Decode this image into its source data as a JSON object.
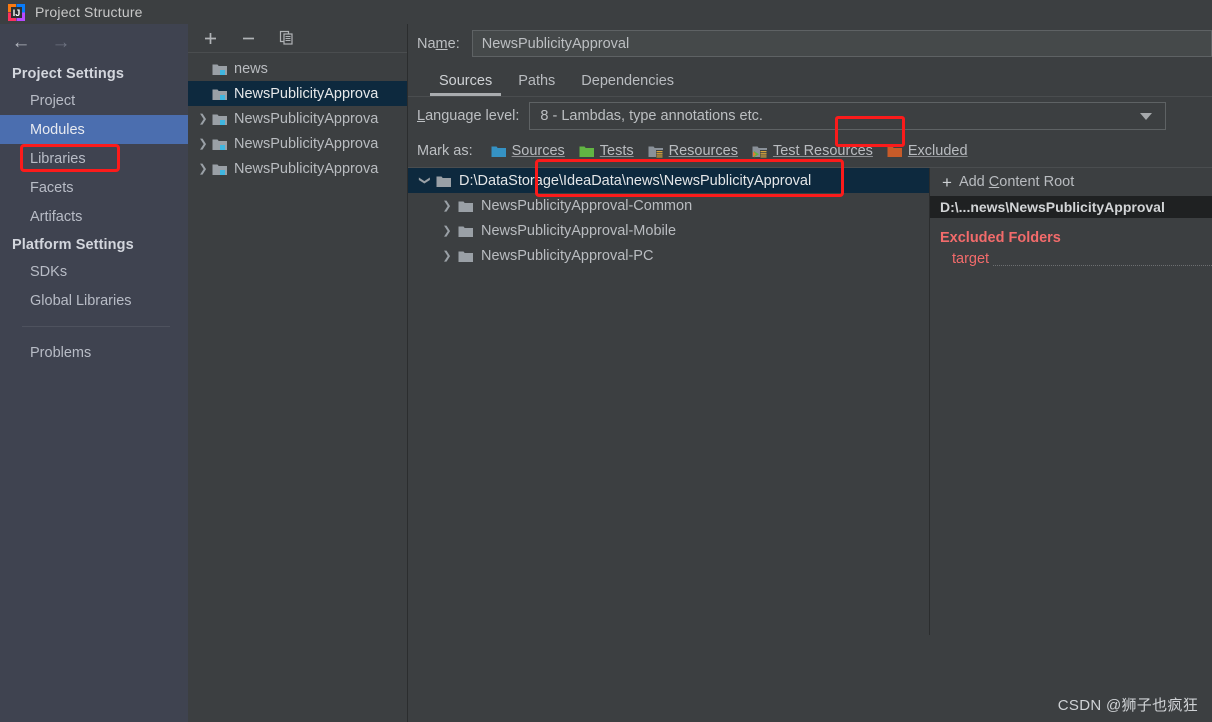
{
  "window": {
    "title": "Project Structure",
    "icon": "intellij-idea-logo"
  },
  "nav": {
    "back_icon": "arrow-left-icon",
    "forward_icon": "arrow-right-icon"
  },
  "sidebar": {
    "groups": [
      {
        "title": "Project Settings",
        "items": [
          {
            "label": "Project",
            "selected": false
          },
          {
            "label": "Modules",
            "selected": true
          },
          {
            "label": "Libraries",
            "selected": false
          },
          {
            "label": "Facets",
            "selected": false
          },
          {
            "label": "Artifacts",
            "selected": false
          }
        ]
      },
      {
        "title": "Platform Settings",
        "items": [
          {
            "label": "SDKs",
            "selected": false
          },
          {
            "label": "Global Libraries",
            "selected": false
          }
        ]
      }
    ],
    "problems_label": "Problems"
  },
  "modules_panel": {
    "toolbar": [
      {
        "name": "add-module-button",
        "glyph": "+"
      },
      {
        "name": "remove-module-button",
        "glyph": "−"
      },
      {
        "name": "copy-module-button",
        "glyph": "copy-icon"
      }
    ],
    "rows": [
      {
        "label": "news",
        "expandable": false,
        "selected": false
      },
      {
        "label": "NewsPublicityApprova",
        "expandable": false,
        "selected": true
      },
      {
        "label": "NewsPublicityApprova",
        "expandable": true,
        "selected": false
      },
      {
        "label": "NewsPublicityApprova",
        "expandable": true,
        "selected": false
      },
      {
        "label": "NewsPublicityApprova",
        "expandable": true,
        "selected": false
      }
    ]
  },
  "details": {
    "name_label": "Name:",
    "name_label_pre": "Na",
    "name_label_mnemonic": "m",
    "name_label_post": "e:",
    "name_value": "NewsPublicityApproval",
    "tabs": [
      {
        "label": "Sources",
        "active": true
      },
      {
        "label": "Paths",
        "active": false
      },
      {
        "label": "Dependencies",
        "active": false
      }
    ],
    "language_level": {
      "label_pre": "L",
      "label_post": "anguage level:",
      "value": "8 - Lambdas, type annotations etc."
    },
    "mark_as": {
      "label": "Mark as:",
      "options": [
        {
          "label": "Sources",
          "pre": "",
          "mnemonic": "S",
          "post": "ources",
          "color": "#3592C4",
          "icon": "folder-sources-icon"
        },
        {
          "label": "Tests",
          "pre": "",
          "mnemonic": "T",
          "post": "ests",
          "color": "#62B543",
          "icon": "folder-tests-icon"
        },
        {
          "label": "Resources",
          "pre": "Res",
          "mnemonic": "",
          "post": "ources",
          "color": "#8a9199",
          "icon": "folder-resources-icon"
        },
        {
          "label": "Test Resources",
          "pre": "Test Resources",
          "mnemonic": "",
          "post": "",
          "color": "#8a9199",
          "icon": "folder-test-resources-icon"
        },
        {
          "label": "Excluded",
          "pre": "",
          "mnemonic": "E",
          "post": "xcluded",
          "color": "#C75B29",
          "icon": "folder-excluded-icon"
        }
      ]
    },
    "tree": [
      {
        "label": "D:\\DataStorage\\IdeaData\\news\\NewsPublicityApproval",
        "depth": 0,
        "expanded": true,
        "selected": true
      },
      {
        "label": "NewsPublicityApproval-Common",
        "depth": 1,
        "expanded": false,
        "selected": false
      },
      {
        "label": "NewsPublicityApproval-Mobile",
        "depth": 1,
        "expanded": false,
        "selected": false
      },
      {
        "label": "NewsPublicityApproval-PC",
        "depth": 1,
        "expanded": false,
        "selected": false
      }
    ]
  },
  "content_roots_panel": {
    "add_label_pre": "Add ",
    "add_label_mnemonic": "C",
    "add_label_post": "ontent Root",
    "add_plus": "+",
    "selected_root": "D:\\...news\\NewsPublicityApproval",
    "excluded_title": "Excluded Folders",
    "excluded_items": [
      "target"
    ]
  },
  "watermark": "CSDN @狮子也疯狂",
  "colors": {
    "background": "#3c3f41",
    "sidebar_bg": "#3f4350",
    "selection_blue": "#4b6eaf",
    "tree_selection": "#0d293e",
    "highlight_red": "#fb1b1b",
    "excluded_red": "#f26b6b"
  }
}
